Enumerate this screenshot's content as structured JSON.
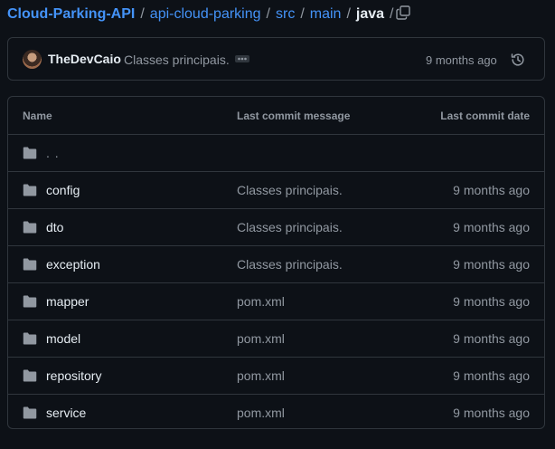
{
  "breadcrumb": {
    "repo": "Cloud-Parking-API",
    "path": [
      "api-cloud-parking",
      "src",
      "main"
    ],
    "current": "java",
    "separator": "/"
  },
  "icons": {
    "copy": "copy-icon",
    "ellipsis": "kebab-horizontal-icon",
    "history": "history-icon",
    "folder": "file-directory-fill-icon"
  },
  "colors": {
    "background": "#0d1117",
    "border": "#30363d",
    "link": "#4493f8",
    "muted": "#9198a1",
    "text": "#e6edf3"
  },
  "latest_commit": {
    "author": "TheDevCaio",
    "message": "Classes principais.",
    "time": "9 months ago"
  },
  "table": {
    "headers": {
      "name": "Name",
      "message": "Last commit message",
      "date": "Last commit date"
    },
    "parent": {
      "name": ". ."
    },
    "rows": [
      {
        "name": "config",
        "message": "Classes principais.",
        "date": "9 months ago"
      },
      {
        "name": "dto",
        "message": "Classes principais.",
        "date": "9 months ago"
      },
      {
        "name": "exception",
        "message": "Classes principais.",
        "date": "9 months ago"
      },
      {
        "name": "mapper",
        "message": "pom.xml",
        "date": "9 months ago"
      },
      {
        "name": "model",
        "message": "pom.xml",
        "date": "9 months ago"
      },
      {
        "name": "repository",
        "message": "pom.xml",
        "date": "9 months ago"
      },
      {
        "name": "service",
        "message": "pom.xml",
        "date": "9 months ago"
      }
    ]
  }
}
